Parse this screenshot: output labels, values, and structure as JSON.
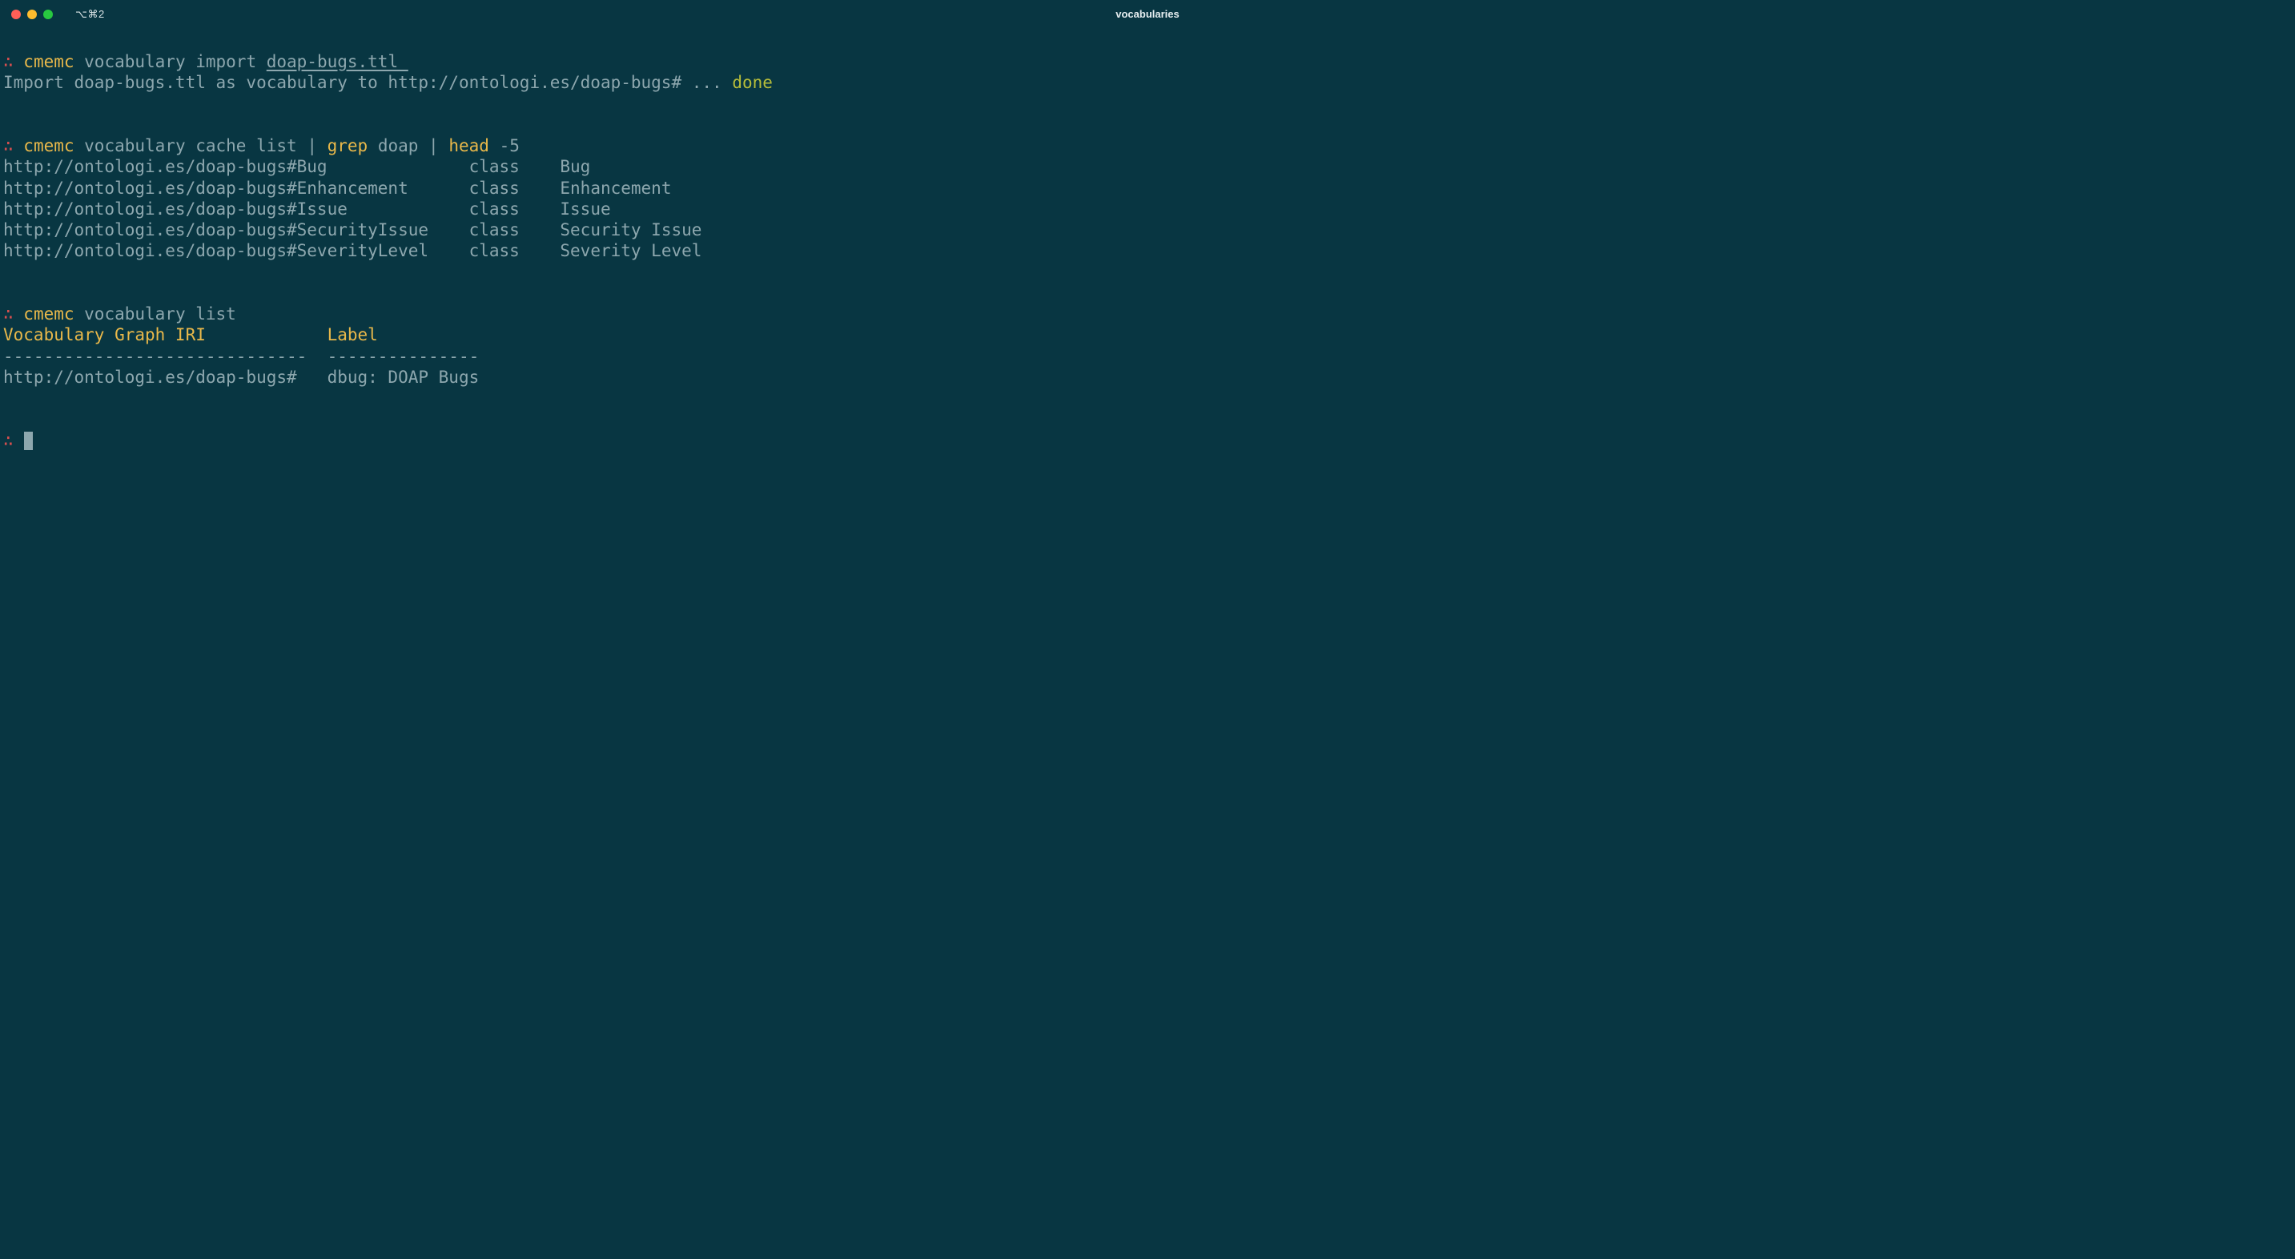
{
  "titlebar": {
    "tab_label": "⌥⌘2",
    "window_title": "vocabularies"
  },
  "prompt_symbol": "∴",
  "commands": {
    "c1": {
      "name": "cmemc",
      "rest_plain": "vocabulary import ",
      "rest_ul": "doap-bugs.ttl "
    },
    "c1_out": {
      "prefix": "Import doap-bugs.ttl as vocabulary to http://ontologi.es/doap-bugs# ... ",
      "done": "done"
    },
    "c2": {
      "name": "cmemc",
      "p1": "vocabulary cache list ",
      "pipe1": "|",
      "grep": " grep ",
      "p2": "doap ",
      "pipe2": "|",
      "head": " head ",
      "p3": "-5"
    },
    "c2_rows": [
      {
        "iri": "http://ontologi.es/doap-bugs#Bug",
        "type": "class",
        "label": "Bug"
      },
      {
        "iri": "http://ontologi.es/doap-bugs#Enhancement",
        "type": "class",
        "label": "Enhancement"
      },
      {
        "iri": "http://ontologi.es/doap-bugs#Issue",
        "type": "class",
        "label": "Issue"
      },
      {
        "iri": "http://ontologi.es/doap-bugs#SecurityIssue",
        "type": "class",
        "label": "Security Issue"
      },
      {
        "iri": "http://ontologi.es/doap-bugs#SeverityLevel",
        "type": "class",
        "label": "Severity Level"
      }
    ],
    "c3": {
      "name": "cmemc",
      "rest": "vocabulary list"
    },
    "c3_header": {
      "col1": "Vocabulary Graph IRI",
      "col2": "Label"
    },
    "c3_divider": {
      "col1": "------------------------------",
      "col2": "---------------"
    },
    "c3_rows": [
      {
        "iri": "http://ontologi.es/doap-bugs#",
        "label": "dbug: DOAP Bugs"
      }
    ]
  },
  "columns": {
    "c2_iri_width": 46,
    "c2_type_width": 9,
    "c3_col1_width": 32
  }
}
